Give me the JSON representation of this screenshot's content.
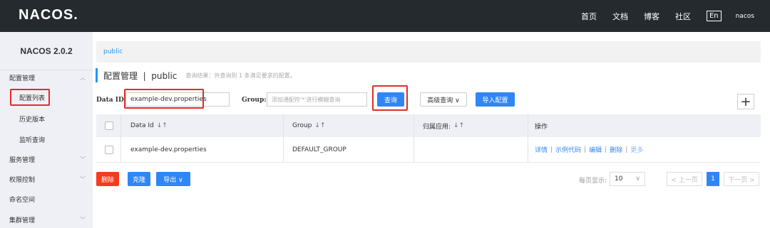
{
  "topbar": {
    "logo": "NACOS.",
    "nav": [
      "首页",
      "文档",
      "博客",
      "社区"
    ],
    "lang": "En",
    "user": "nacos"
  },
  "sidebar": {
    "version": "NACOS 2.0.2",
    "items": [
      {
        "label": "配置管理",
        "chevron": "︿"
      },
      {
        "label": "配置列表"
      },
      {
        "label": "历史版本"
      },
      {
        "label": "监听查询"
      },
      {
        "label": "服务管理",
        "chevron": "﹀"
      },
      {
        "label": "权限控制",
        "chevron": "﹀"
      },
      {
        "label": "命名空间"
      },
      {
        "label": "集群管理",
        "chevron": "﹀"
      }
    ]
  },
  "main": {
    "namespace_tab": "public",
    "header_title": "配置管理  |  public",
    "header_sub": "查询结果：共查询到 1 条满足要求的配置。",
    "dataid_label": "Data ID:",
    "dataid_value": "example-dev.properties",
    "group_label": "Group:",
    "group_placeholder": "添加通配符'*'进行模糊查询",
    "query_button": "查询",
    "advanced_button": "高级查询 ∨",
    "import_button": "导入配置",
    "add_icon": "+"
  },
  "table": {
    "columns": [
      "Data Id",
      "Group",
      "归属应用:",
      "操作"
    ],
    "sort_icon": "↓↑",
    "rows": [
      {
        "data_id": "example-dev.properties",
        "group": "DEFAULT_GROUP",
        "app": "",
        "ops": [
          "详情",
          "示例代码",
          "编辑",
          "删除",
          "更多"
        ]
      }
    ]
  },
  "footer": {
    "delete": "删除",
    "clone": "克隆",
    "export": "导出 ∨",
    "page_size_label": "每页显示:",
    "page_size": "10",
    "prev": "< 上一页",
    "current_page": "1",
    "next": "下一页 >"
  },
  "colors": {
    "accent": "#2f86f6",
    "danger": "#f53b1e",
    "topbar": "#252a2f",
    "highlight": "#e32b2b"
  }
}
